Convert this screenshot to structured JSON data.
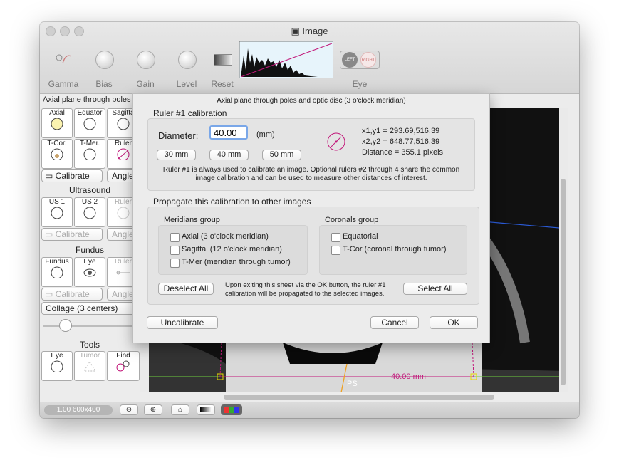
{
  "window": {
    "title": "Image"
  },
  "toolbar": {
    "labels": [
      "Gamma",
      "Bias",
      "Gain",
      "Level",
      "Reset",
      "Eye"
    ],
    "eye_left": "LEFT",
    "eye_right": "RIGHT"
  },
  "left_panel": {
    "plane_label": "Axial plane through poles an",
    "tools_row1": [
      "Axial",
      "Equator",
      "Sagitta"
    ],
    "tools_row2": [
      "T-Cor.",
      "T-Mer.",
      "Ruler"
    ],
    "calibrate_label": "Calibrate",
    "angle_label": "Angle",
    "ultrasound_title": "Ultrasound",
    "us_tools": [
      "US 1",
      "US 2",
      "Ruler"
    ],
    "fundus_title": "Fundus",
    "fundus_tools": [
      "Fundus",
      "Eye",
      "Ruler"
    ],
    "collage_label": "Collage (3 centers)",
    "tools_title": "Tools",
    "misc_tools": [
      "Eye",
      "Tumor",
      "Find"
    ]
  },
  "status": {
    "zoom": "1.00 600x400"
  },
  "image_overlay": {
    "ruler_label": "40.00 mm",
    "ps_label": "PS"
  },
  "sheet": {
    "header": "Axial plane through poles and optic disc (3 o'clock meridian)",
    "ruler_title": "Ruler #1 calibration",
    "diameter_label": "Diameter:",
    "diameter_value": "40.00",
    "unit": "(mm)",
    "preset_buttons": [
      "30 mm",
      "40 mm",
      "50 mm"
    ],
    "coords": [
      "x1,y1 = 293.69,516.39",
      "x2,y2 = 648.77,516.39",
      "Distance = 355.1 pixels"
    ],
    "note_line1": "Ruler #1 is always used to calibrate an image. Optional rulers #2 through 4 share the common",
    "note_line2": "image calibration and can be used to measure other distances of interest.",
    "propagate_title": "Propagate this calibration to other images",
    "meridians_title": "Meridians group",
    "meridians": [
      "Axial (3 o'clock meridian)",
      "Sagittal (12 o'clock meridian)",
      "T-Mer (meridian through tumor)"
    ],
    "coronals_title": "Coronals group",
    "coronals": [
      "Equatorial",
      "T-Cor (coronal through tumor)"
    ],
    "deselect_all": "Deselect All",
    "select_all": "Select All",
    "exit_note_line1": "Upon exiting this sheet via the OK button, the ruler #1",
    "exit_note_line2": "calibration will be propagated to the selected images.",
    "uncalibrate": "Uncalibrate",
    "cancel": "Cancel",
    "ok": "OK"
  },
  "colors": {
    "accent": "#c2187a",
    "ruler_line": "#c2187a",
    "green_line": "#6ccf3c",
    "blue_line": "#2b5bd7"
  }
}
